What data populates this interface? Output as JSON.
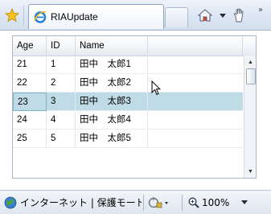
{
  "tab": {
    "title": "RIAUpdate"
  },
  "grid": {
    "columns": [
      "Age",
      "ID",
      "Name",
      ""
    ],
    "rows": [
      {
        "age": "21",
        "id": "1",
        "name": "田中　太郎1"
      },
      {
        "age": "22",
        "id": "2",
        "name": "田中　太郎2"
      },
      {
        "age": "23",
        "id": "3",
        "name": "田中　太郎3"
      },
      {
        "age": "24",
        "id": "4",
        "name": "田中　太郎4"
      },
      {
        "age": "25",
        "id": "5",
        "name": "田中　太郎5"
      }
    ],
    "selected_row_index": 2
  },
  "status": {
    "zone": "インターネット | 保護モード",
    "zoom": "100%"
  },
  "colors": {
    "selection": "#bedbe6",
    "toolbar": "#dbe5f2"
  }
}
